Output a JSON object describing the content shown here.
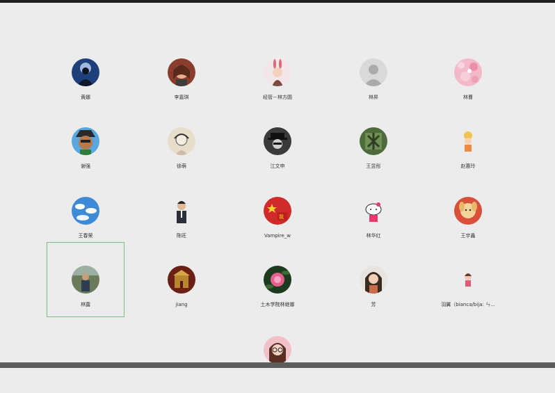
{
  "contacts": [
    {
      "name": "黄娜",
      "avatar": "silhouette-night-avatar"
    },
    {
      "name": "李嘉琪",
      "avatar": "girl-portrait-avatar"
    },
    {
      "name": "经管－林方圆",
      "avatar": "bunny-girl-avatar"
    },
    {
      "name": "林昇",
      "avatar": "default-person-avatar"
    },
    {
      "name": "林曹",
      "avatar": "pink-floral-avatar"
    },
    {
      "name": "谢强",
      "avatar": "cartoon-pirate-avatar"
    },
    {
      "name": "徐萌",
      "avatar": "sketch-girl-avatar"
    },
    {
      "name": "江文申",
      "avatar": "hat-man-avatar"
    },
    {
      "name": "王昱彤",
      "avatar": "green-calligraphy-avatar"
    },
    {
      "name": "赵惠玲",
      "avatar": "cartoon-baby-avatar"
    },
    {
      "name": "王春荣",
      "avatar": "blue-sky-avatar"
    },
    {
      "name": "陈旺",
      "avatar": "suit-man-avatar"
    },
    {
      "name": "Vampire_w",
      "avatar": "red-flag-avatar"
    },
    {
      "name": "林华红",
      "avatar": "hello-kitty-avatar"
    },
    {
      "name": "王宇鑫",
      "avatar": "cartoon-dog-avatar"
    },
    {
      "name": "林露",
      "avatar": "outdoor-person-avatar"
    },
    {
      "name": "jiang",
      "avatar": "dark-red-building-avatar"
    },
    {
      "name": "土木学院林继娜",
      "avatar": "pink-flower-avatar"
    },
    {
      "name": "芳",
      "avatar": "selfie-woman-avatar"
    },
    {
      "name": "羽翼（bianca/bija: ㄣ...",
      "avatar": "cartoon-girl-avatar"
    },
    {
      "name": "",
      "avatar": "glasses-woman-avatar"
    }
  ],
  "selected_index": 15,
  "colors": {
    "background": "#ececec",
    "selection_border": "#74c27d",
    "name_text": "#333333"
  }
}
